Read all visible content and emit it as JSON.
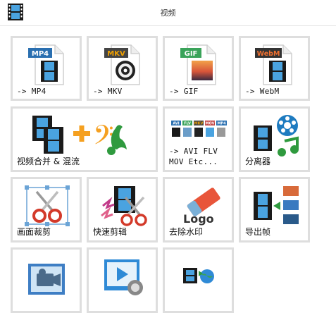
{
  "header": {
    "title": "视频",
    "icon": "film-strip-icon"
  },
  "tiles": [
    {
      "label": "-> MP4",
      "badge": "MP4",
      "badge_color": "#2a6fb0"
    },
    {
      "label": "-> MKV",
      "badge": "MKV",
      "badge_color": "#444444",
      "badge_text_color": "#f0a000"
    },
    {
      "label": "-> GIF",
      "badge": "GIF",
      "badge_color": "#3aa35a"
    },
    {
      "label": "-> WebM",
      "badge": "WebM",
      "badge_color": "#333333",
      "badge_text_color": "#f07030"
    },
    {
      "label": "视频合并 & 混流"
    },
    {
      "label": "-> AVI FLV\nMOV Etc...",
      "mini_badges": [
        "AVI",
        "FLV",
        "MOV",
        "MKV",
        "MP4"
      ]
    },
    {
      "label": "分离器"
    },
    {
      "label": "画面裁剪"
    },
    {
      "label": "快速剪辑"
    },
    {
      "label": "去除水印",
      "watermark_text": "Logo"
    },
    {
      "label": "导出帧"
    },
    {
      "label": ""
    },
    {
      "label": ""
    },
    {
      "label": ""
    }
  ],
  "colors": {
    "accent": "#2a6fb0",
    "tile_border": "#dedede",
    "orange": "#f5a020",
    "green": "#2f9a3e"
  }
}
